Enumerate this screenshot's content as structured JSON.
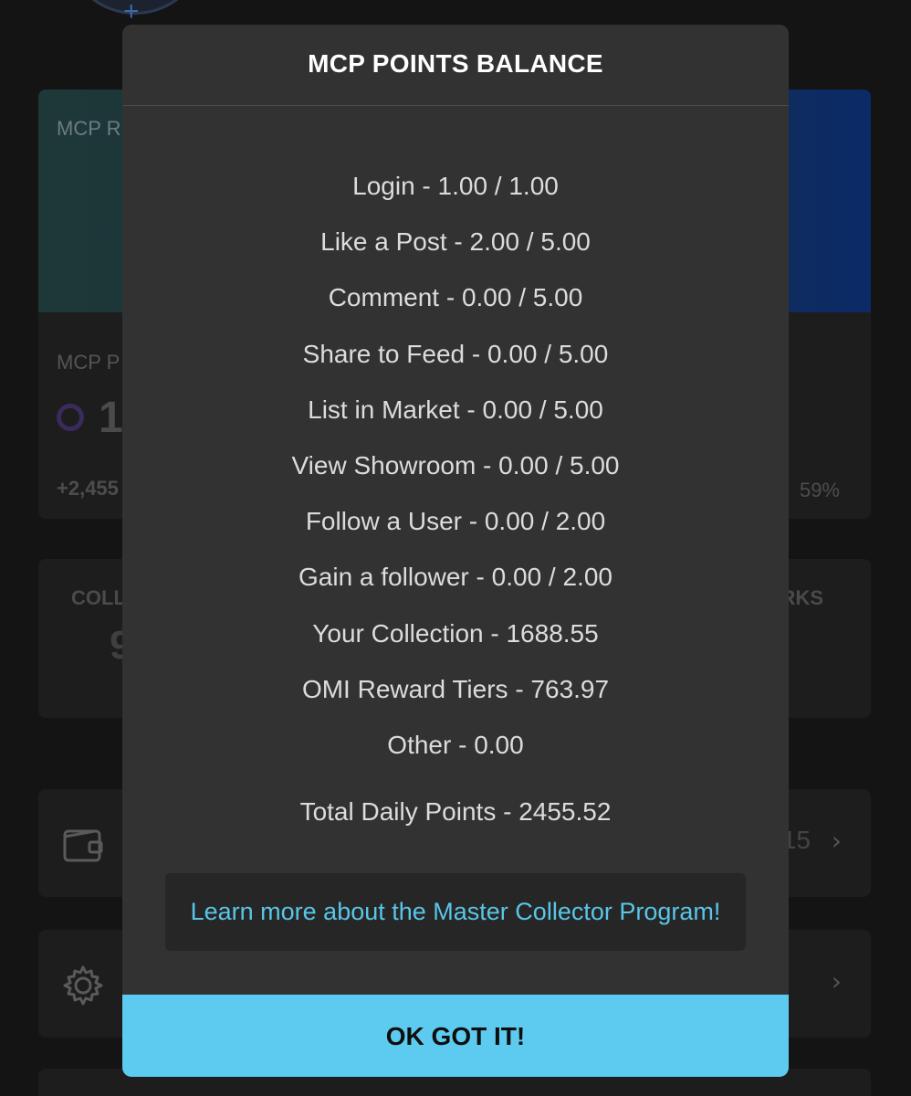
{
  "background": {
    "rank_card": {
      "title": "MCP R",
      "points_label": "MCP P",
      "points_value": "1",
      "points_delta": "+2,455",
      "points_percent": "59%"
    },
    "stats_card": {
      "left_label": "COLL",
      "left_value": "9",
      "right_label": "RKS"
    },
    "wallet_row": {
      "value": "15",
      "chevron": "›"
    },
    "settings_row": {
      "chevron": "›"
    }
  },
  "modal": {
    "title": "MCP POINTS BALANCE",
    "items": [
      "Login - 1.00 / 1.00",
      "Like a Post - 2.00 / 5.00",
      "Comment - 0.00 / 5.00",
      "Share to Feed - 0.00 / 5.00",
      "List in Market - 0.00 / 5.00",
      "View Showroom - 0.00 / 5.00",
      "Follow a User - 0.00 / 2.00",
      "Gain a follower - 0.00 / 2.00",
      "Your Collection - 1688.55",
      "OMI Reward Tiers - 763.97",
      "Other - 0.00"
    ],
    "total": "Total Daily Points - 2455.52",
    "learn_more": "Learn more about the Master Collector Program!",
    "ok_button": "OK GOT IT!"
  },
  "colors": {
    "accent": "#5ccbef",
    "link": "#59c6e8",
    "modal_bg": "#323232",
    "page_bg": "#141414"
  }
}
